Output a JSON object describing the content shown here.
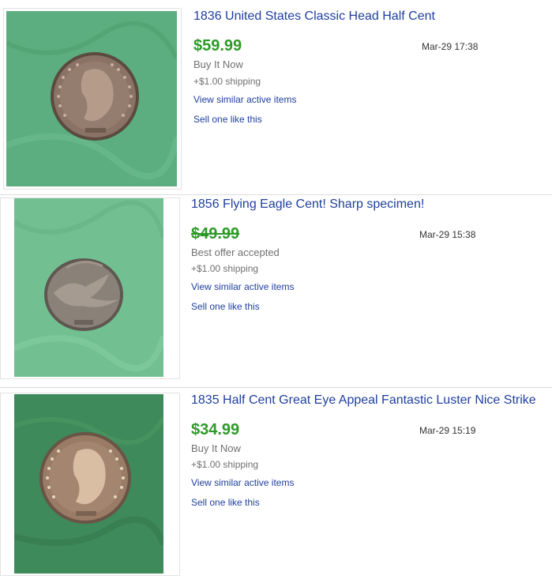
{
  "listings": [
    {
      "title": "1836 United States Classic Head Half Cent",
      "price": "$59.99",
      "date": "Mar-29 17:38",
      "status": "Buy It Now",
      "shipping": "+$1.00 shipping",
      "similar_link": "View similar active items",
      "sell_link": "Sell one like this",
      "image_bg": "#5cae80",
      "coin_tone": "#8a7265",
      "price_color": "#2c9a27"
    },
    {
      "title": "1856 Flying Eagle Cent! Sharp specimen!",
      "price": "$49.99",
      "date": "Mar-29 15:38",
      "status": "Best offer accepted",
      "shipping": "+$1.00 shipping",
      "similar_link": "View similar active items",
      "sell_link": "Sell one like this",
      "image_bg": "#72c091",
      "coin_tone": "#8a8178",
      "price_color": "#2c9a27"
    },
    {
      "title": "1835 Half Cent Great Eye Appeal Fantastic Luster Nice Strike",
      "price": "$34.99",
      "date": "Mar-29 15:19",
      "status": "Buy It Now",
      "shipping": "+$1.00 shipping",
      "similar_link": "View similar active items",
      "sell_link": "Sell one like this",
      "image_bg": "#3e8a5a",
      "coin_tone": "#9a7c66",
      "price_color": "#2c9a27"
    }
  ]
}
